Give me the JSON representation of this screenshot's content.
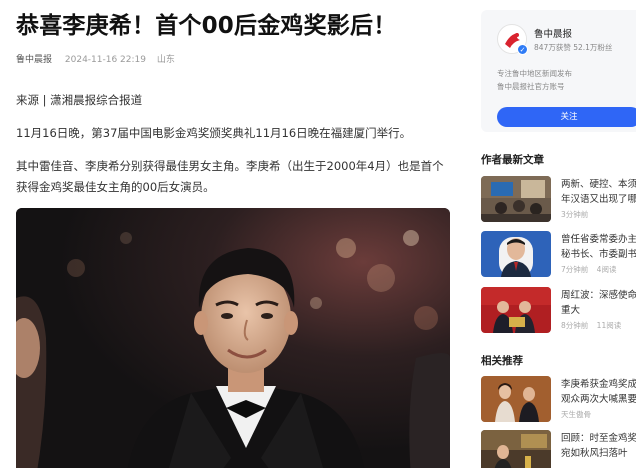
{
  "article": {
    "title": "恭喜李庚希！首个00后金鸡奖影后！",
    "source": "鲁中晨报",
    "time": "2024-11-16 22:19",
    "location": "山东",
    "paragraphs": [
      "来源 | 潇湘晨报综合报道",
      "11月16日晚，第37届中国电影金鸡奖颁奖典礼11月16日晚在福建厦门举行。",
      "其中雷佳音、李庚希分别获得最佳男女主角。李庚希（出生于2000年4月）也是首个获得金鸡奖最佳女主角的00后女演员。"
    ]
  },
  "author": {
    "name": "鲁中晨报",
    "stats": "847万获赞 52.1万粉丝",
    "desc_line1": "专注鲁中地区新闻发布",
    "desc_line2": "鲁中晨报社官方账号",
    "follow_label": "关注"
  },
  "latest": {
    "title": "作者最新文章",
    "items": [
      {
        "title_l1": "两新、硬控、本须",
        "title_l2": "年汉语又出现了哪",
        "time": "3分钟前",
        "reads": ""
      },
      {
        "title_l1": "曾任省委常委办主",
        "title_l2": "秘书长、市委副书",
        "time": "7分钟前",
        "reads": "4阅读"
      },
      {
        "title_l1": "周红波：深感使命",
        "title_l2": "重大",
        "time": "8分钟前",
        "reads": "11阅读"
      }
    ]
  },
  "related": {
    "title": "相关推荐",
    "items": [
      {
        "title_l1": "李庚希获金鸡奖成",
        "title_l2": "观众两次大喊黑要",
        "time": "天生傲骨",
        "reads": ""
      },
      {
        "title_l1": "回顾：时至金鸡奖",
        "title_l2": "宛如秋风扫落叶",
        "time": "",
        "reads": ""
      }
    ]
  },
  "colors": {
    "accent": "#2f66f6",
    "title": "#111111",
    "meta": "#9a9a9a",
    "card_bg": "#f6f7f9"
  }
}
